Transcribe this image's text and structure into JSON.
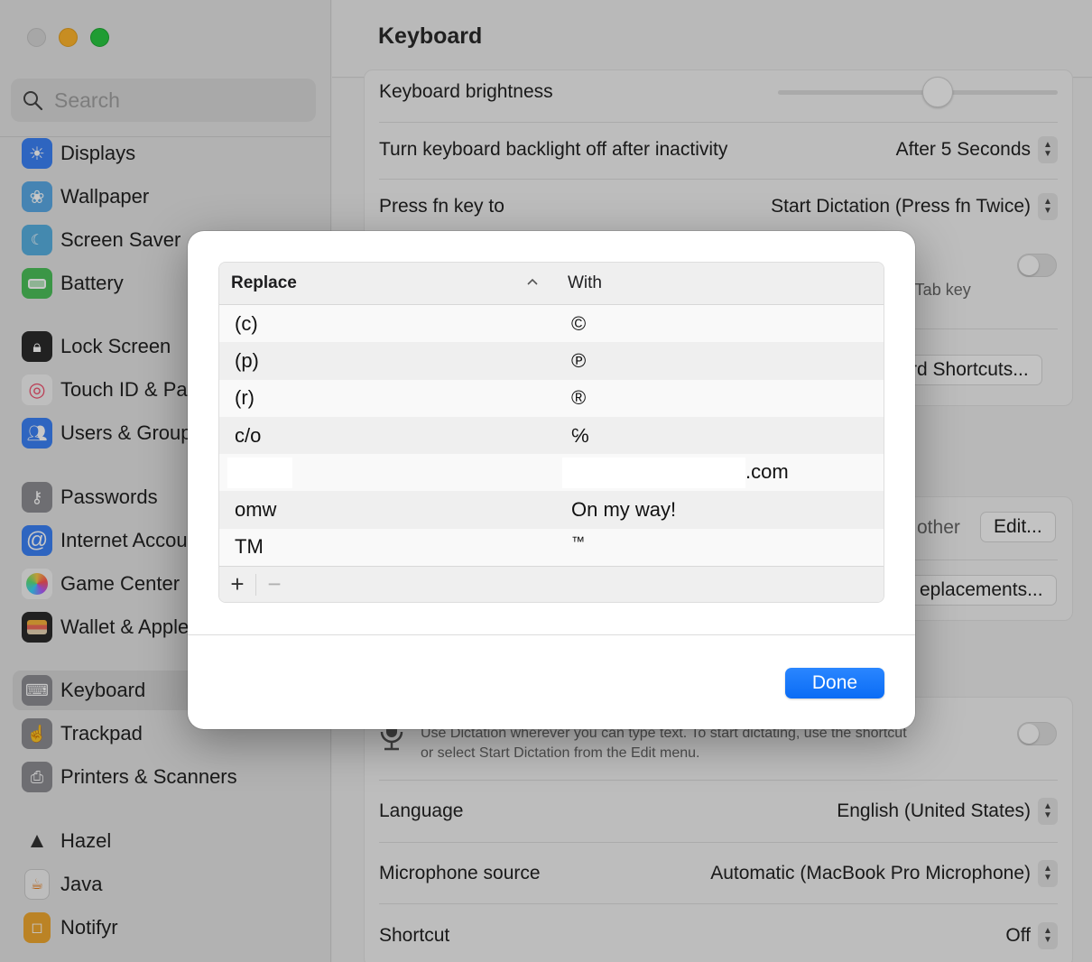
{
  "window": {
    "traffic_lights": [
      "close",
      "minimize",
      "maximize"
    ]
  },
  "sidebar": {
    "search_placeholder": "Search",
    "items": [
      {
        "label": "Displays",
        "icon": "sun-icon",
        "color": "#3b82f6"
      },
      {
        "label": "Wallpaper",
        "icon": "flower-icon",
        "color": "#5aa9e6"
      },
      {
        "label": "Screen Saver",
        "icon": "screensaver-icon",
        "color": "#58b0e0"
      },
      {
        "label": "Battery",
        "icon": "battery-icon",
        "color": "#4cc05a"
      },
      {
        "label": "Lock Screen",
        "icon": "lock-icon",
        "color": "#2b2b2b"
      },
      {
        "label": "Touch ID & Password",
        "icon": "fingerprint-icon",
        "color": "#f4f4f4"
      },
      {
        "label": "Users & Groups",
        "icon": "users-icon",
        "color": "#3b82f6"
      },
      {
        "label": "Passwords",
        "icon": "key-icon",
        "color": "#8e8e93"
      },
      {
        "label": "Internet Accounts",
        "icon": "at-icon",
        "color": "#3b82f6"
      },
      {
        "label": "Game Center",
        "icon": "game-center-icon",
        "color": "#f4f4f4"
      },
      {
        "label": "Wallet & Apple Pay",
        "icon": "wallet-icon",
        "color": "#2b2b2b"
      },
      {
        "label": "Keyboard",
        "icon": "keyboard-icon",
        "color": "#8e8e93",
        "active": true
      },
      {
        "label": "Trackpad",
        "icon": "trackpad-icon",
        "color": "#8e8e93"
      },
      {
        "label": "Printers & Scanners",
        "icon": "printer-icon",
        "color": "#8e8e93"
      },
      {
        "label": "Hazel",
        "icon": "hazel-duster-icon",
        "color": "transparent"
      },
      {
        "label": "Java",
        "icon": "java-icon",
        "color": "#f2f2f2"
      },
      {
        "label": "Notifyr",
        "icon": "notifyr-icon",
        "color": "#f0a830"
      }
    ]
  },
  "main": {
    "title": "Keyboard",
    "keyboard_brightness": {
      "label": "Keyboard brightness",
      "value_fraction": 0.57
    },
    "backlight_off": {
      "label": "Turn keyboard backlight off after inactivity",
      "value": "After 5 Seconds"
    },
    "fn_key": {
      "label": "Press fn key to",
      "value": "Start Dictation (Press fn Twice)"
    },
    "tab_key_hint": "e Tab key",
    "keyboard_shortcuts_button": "rd Shortcuts...",
    "input_sources_other": "other",
    "edit_button": "Edit...",
    "text_replacements_button": "eplacements...",
    "dictation": {
      "description_line1": "Use Dictation wherever you can type text. To start dictating, use the shortcut",
      "description_line2": "or select Start Dictation from the Edit menu.",
      "enabled": false
    },
    "language": {
      "label": "Language",
      "value": "English (United States)"
    },
    "microphone": {
      "label": "Microphone source",
      "value": "Automatic (MacBook Pro Microphone)"
    },
    "shortcut": {
      "label": "Shortcut",
      "value": "Off"
    }
  },
  "sheet": {
    "columns": {
      "replace": "Replace",
      "with": "With",
      "sort_indicator": "^"
    },
    "rows": [
      {
        "replace": "(c)",
        "with": "©"
      },
      {
        "replace": "(p)",
        "with": "℗"
      },
      {
        "replace": "(r)",
        "with": "®"
      },
      {
        "replace": "c/o",
        "with": "℅"
      },
      {
        "replace": "",
        "with": ".com",
        "redacted": true
      },
      {
        "replace": "omw",
        "with": "On my way!"
      },
      {
        "replace": "TM",
        "with": "™"
      }
    ],
    "add_button": "+",
    "remove_button": "−",
    "done_button": "Done",
    "accent_color": "#0a6cf5"
  }
}
